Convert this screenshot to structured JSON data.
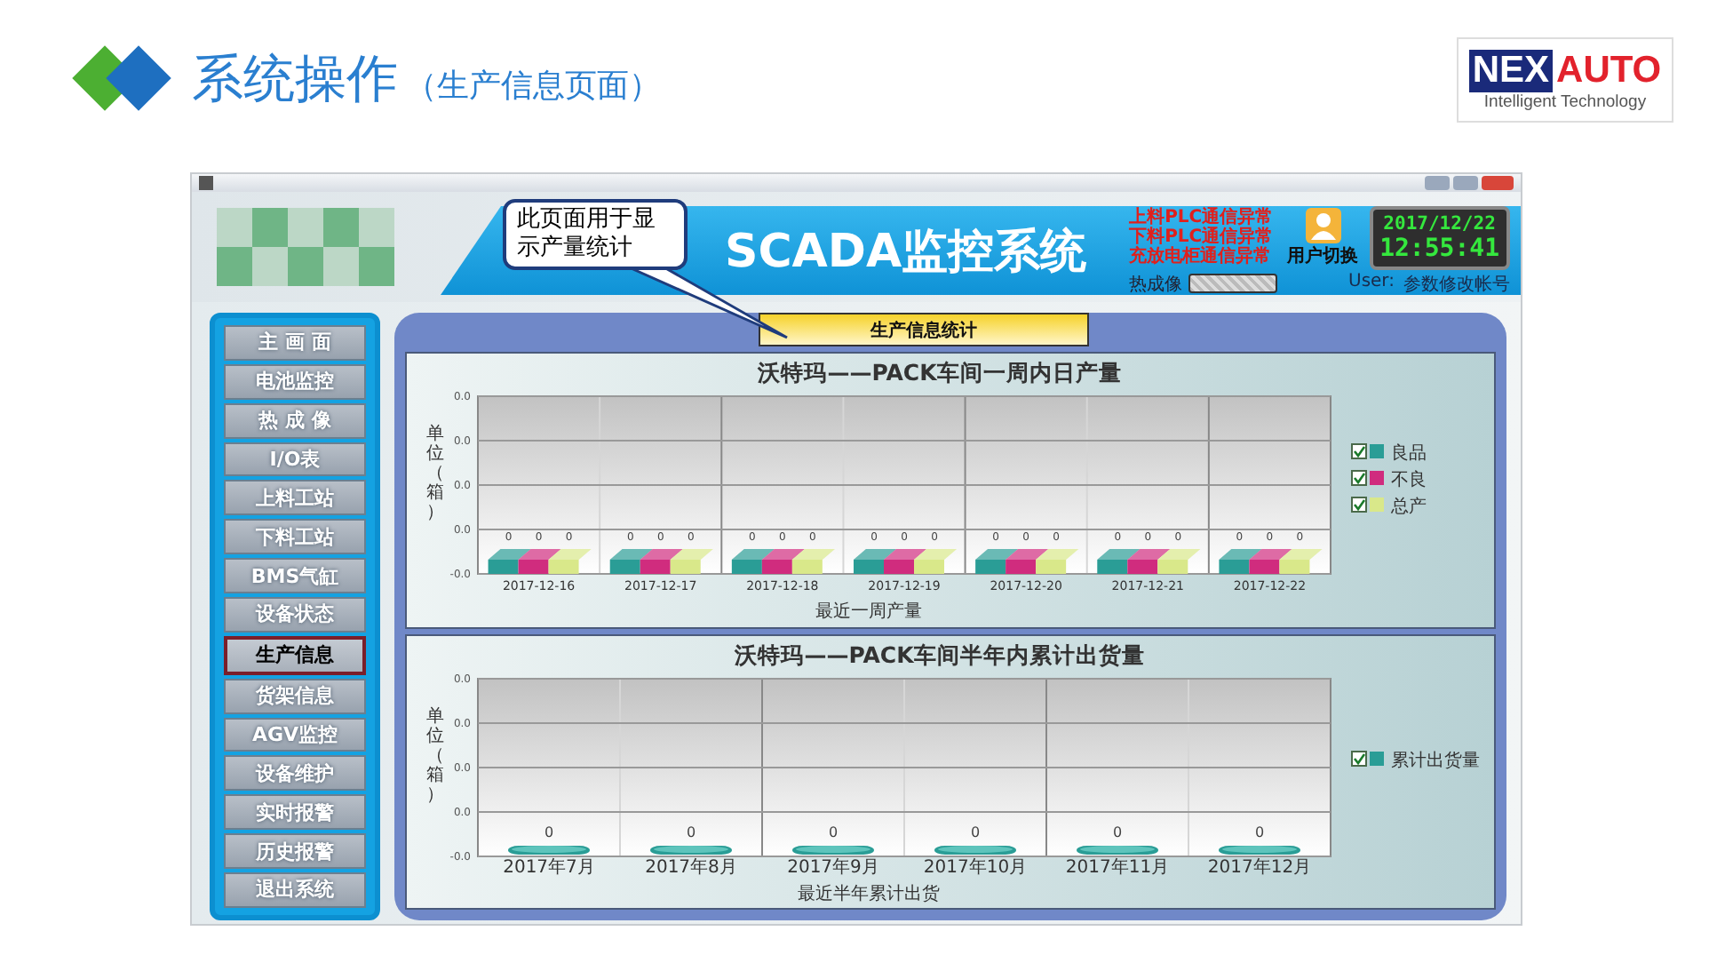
{
  "slide": {
    "title": "系统操作",
    "subtitle": "（生产信息页面）",
    "logo": {
      "mark": "NEX",
      "word": "AUTO",
      "tagline": "Intelligent Technology"
    }
  },
  "app": {
    "banner_title": "SCADA监控系统",
    "alarms": [
      "上料PLC通信异常",
      "下料PLC通信异常",
      "充放电柜通信异常"
    ],
    "thermal_label": "热成像",
    "user_switch": "用户切换",
    "clock": {
      "date": "2017/12/22",
      "time": "12:55:41"
    },
    "user_label": "User:",
    "user_name": "参数修改帐号"
  },
  "callout": "此页面用于显示产量统计",
  "nav": [
    {
      "label": "主 画 面",
      "selected": false
    },
    {
      "label": "电池监控",
      "selected": false
    },
    {
      "label": "热 成 像",
      "selected": false
    },
    {
      "label": "I/O表",
      "selected": false
    },
    {
      "label": "上料工站",
      "selected": false
    },
    {
      "label": "下料工站",
      "selected": false
    },
    {
      "label": "BMS气缸",
      "selected": false
    },
    {
      "label": "设备状态",
      "selected": false
    },
    {
      "label": "生产信息",
      "selected": true
    },
    {
      "label": "货架信息",
      "selected": false
    },
    {
      "label": "AGV监控",
      "selected": false
    },
    {
      "label": "设备维护",
      "selected": false
    },
    {
      "label": "实时报警",
      "selected": false
    },
    {
      "label": "历史报警",
      "selected": false
    },
    {
      "label": "退出系统",
      "selected": false
    }
  ],
  "tab": {
    "label": "生产信息统计",
    "selected": true
  },
  "charts": [
    {
      "kind": "box3d",
      "title": "沃特玛——PACK车间一周内日产量",
      "x_axis_title": "最近一周产量",
      "y_axis_title": "单位（箱）",
      "y_axis_labels": [
        "0.0",
        "0.0",
        "0.0",
        "0.0",
        "-0.0"
      ],
      "categories": [
        "2017-12-16",
        "2017-12-17",
        "2017-12-18",
        "2017-12-19",
        "2017-12-20",
        "2017-12-21",
        "2017-12-22"
      ],
      "series": [
        {
          "name": "良品",
          "color": "#2a9d96",
          "checked": true,
          "value_labels": [
            "0",
            "0",
            "0",
            "0",
            "0",
            "0",
            "0"
          ]
        },
        {
          "name": "不良",
          "color": "#d02c7e",
          "checked": true,
          "value_labels": [
            "0",
            "0",
            "0",
            "0",
            "0",
            "0",
            "0"
          ]
        },
        {
          "name": "总产",
          "color": "#d9e88a",
          "checked": true,
          "value_labels": [
            "0",
            "0",
            "0",
            "0",
            "0",
            "0",
            "0"
          ]
        }
      ]
    },
    {
      "kind": "cylinder",
      "title": "沃特玛——PACK车间半年内累计出货量",
      "x_axis_title": "最近半年累计出货",
      "y_axis_title": "单位（箱）",
      "y_axis_labels": [
        "0.0",
        "0.0",
        "0.0",
        "0.0",
        "-0.0"
      ],
      "categories": [
        "2017年7月",
        "2017年8月",
        "2017年9月",
        "2017年10月",
        "2017年11月",
        "2017年12月"
      ],
      "series": [
        {
          "name": "累计出货量",
          "color": "#2a9d96",
          "checked": true,
          "value_labels": [
            "0",
            "0",
            "0",
            "0",
            "0",
            "0"
          ]
        }
      ]
    }
  ]
}
